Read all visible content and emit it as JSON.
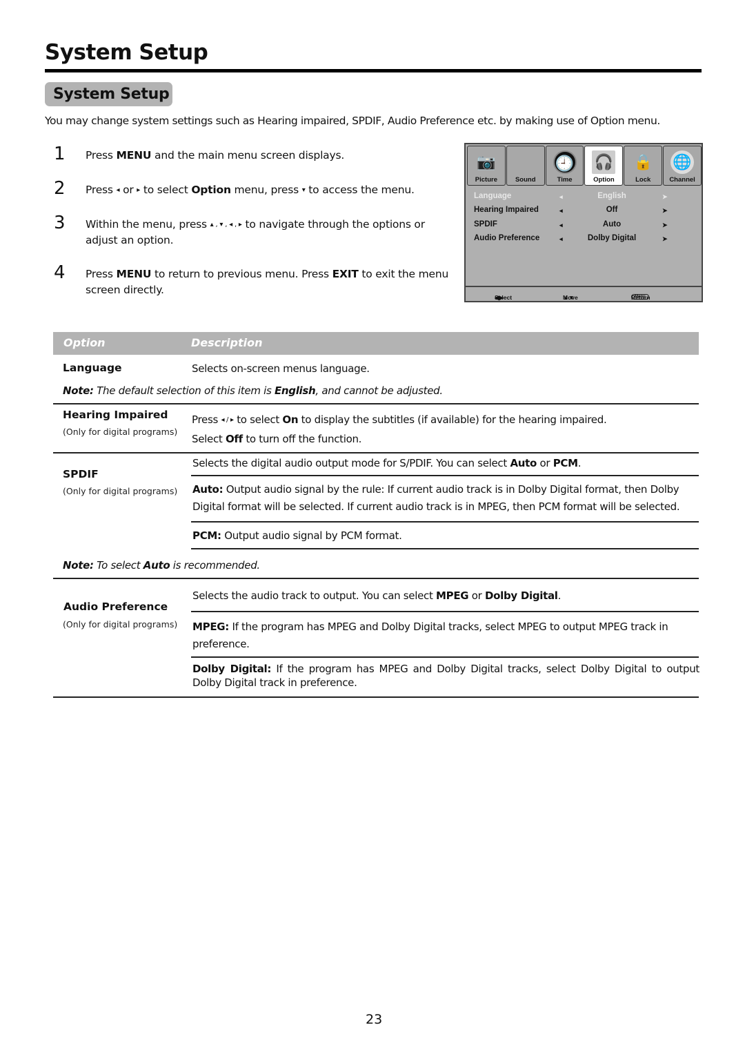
{
  "page": {
    "title": "System Setup",
    "section_badge": "System Setup",
    "intro": "You may change system settings such as Hearing impaired, SPDIF, Audio Preference etc. by making use of Option menu.",
    "page_number": "23"
  },
  "steps": [
    {
      "num": "1",
      "parts": [
        "Press ",
        "MENU",
        " and the main menu screen displays."
      ]
    },
    {
      "num": "2",
      "parts": [
        "Press ",
        "◂",
        " or ",
        "▸",
        " to select ",
        "Option",
        " menu,  press ",
        "▾",
        " to access the menu."
      ]
    },
    {
      "num": "3",
      "parts": [
        "Within the menu, press ",
        "▴ , ▾ , ◂ , ▸",
        " to navigate through the options or adjust an option."
      ]
    },
    {
      "num": "4",
      "parts": [
        "Press ",
        "MENU",
        " to return to previous menu. Press ",
        "EXIT",
        " to exit the menu screen directly."
      ]
    }
  ],
  "tv_menu": {
    "tabs": [
      {
        "label": "Picture",
        "icon": "camera-icon",
        "glyph": "📷",
        "active": false
      },
      {
        "label": "Sound",
        "icon": "sound-icon",
        "glyph": "",
        "active": false
      },
      {
        "label": "Time",
        "icon": "clock-icon",
        "glyph": "🕘",
        "active": false
      },
      {
        "label": "Option",
        "icon": "headphones-icon",
        "glyph": "🎧",
        "active": true
      },
      {
        "label": "Lock",
        "icon": "lock-icon",
        "glyph": "🔒",
        "active": false
      },
      {
        "label": "Channel",
        "icon": "globe-icon",
        "glyph": "🌐",
        "active": false
      }
    ],
    "rows": [
      {
        "label": "Language",
        "value": "English",
        "disabled": true
      },
      {
        "label": "Hearing Impaired",
        "value": "Off",
        "disabled": false
      },
      {
        "label": "SPDIF",
        "value": "Auto",
        "disabled": false
      },
      {
        "label": "Audio Preference",
        "value": "Dolby Digital",
        "disabled": false
      }
    ],
    "left_arrow": "◂",
    "right_arrow": "➤",
    "footer": {
      "select": "Select",
      "move": "Move",
      "menu_key": "Menu",
      "return": "Return",
      "select_glyph": "◀▶",
      "move_glyph": "▲▼"
    }
  },
  "table": {
    "header_option": "Option",
    "header_description": "Description",
    "only_digital": "(Only for digital programs)",
    "language": {
      "name": "Language",
      "desc": "Selects on-screen menus language.",
      "note_label": "Note:",
      "note_pre": " The default selection of this item is ",
      "note_bold": "English",
      "note_post": ", and cannot be adjusted."
    },
    "hearing": {
      "name": "Hearing Impaired",
      "line1_pre": "Press ",
      "line1_arrows": "◂ / ▸",
      "line1_mid": " to select ",
      "line1_bold": "On",
      "line1_post": " to display the subtitles (if available) for the hearing impaired.",
      "line2_pre": "Select ",
      "line2_bold": "Off",
      "line2_post": " to turn off the function."
    },
    "spdif": {
      "name": "SPDIF",
      "desc_pre": "Selects the digital audio output mode for S/PDIF. You can select ",
      "desc_b1": "Auto",
      "desc_mid": " or ",
      "desc_b2": "PCM",
      "desc_post": ".",
      "auto_label": "Auto:",
      "auto_text": " Output audio signal by the rule: If current audio track is in Dolby Digital format, then Dolby Digital format will be selected. If current audio track is in MPEG, then PCM format will be selected.",
      "pcm_label": "PCM:",
      "pcm_text": " Output audio signal by PCM format.",
      "note_label": "Note:",
      "note_pre": " To select ",
      "note_bold": "Auto",
      "note_post": " is recommended."
    },
    "audio_pref": {
      "name": "Audio Preference",
      "desc_pre": "Selects the audio track to output. You can select ",
      "desc_b1": "MPEG",
      "desc_mid": " or ",
      "desc_b2": "Dolby Digital",
      "desc_post": ".",
      "mpeg_label": "MPEG:",
      "mpeg_text": " If the program has MPEG and Dolby Digital tracks, select MPEG to output MPEG track in preference.",
      "dolby_label": "Dolby Digital:",
      "dolby_text": " If the program has MPEG and Dolby Digital tracks, select Dolby Digital to output Dolby Digital track in preference."
    }
  }
}
